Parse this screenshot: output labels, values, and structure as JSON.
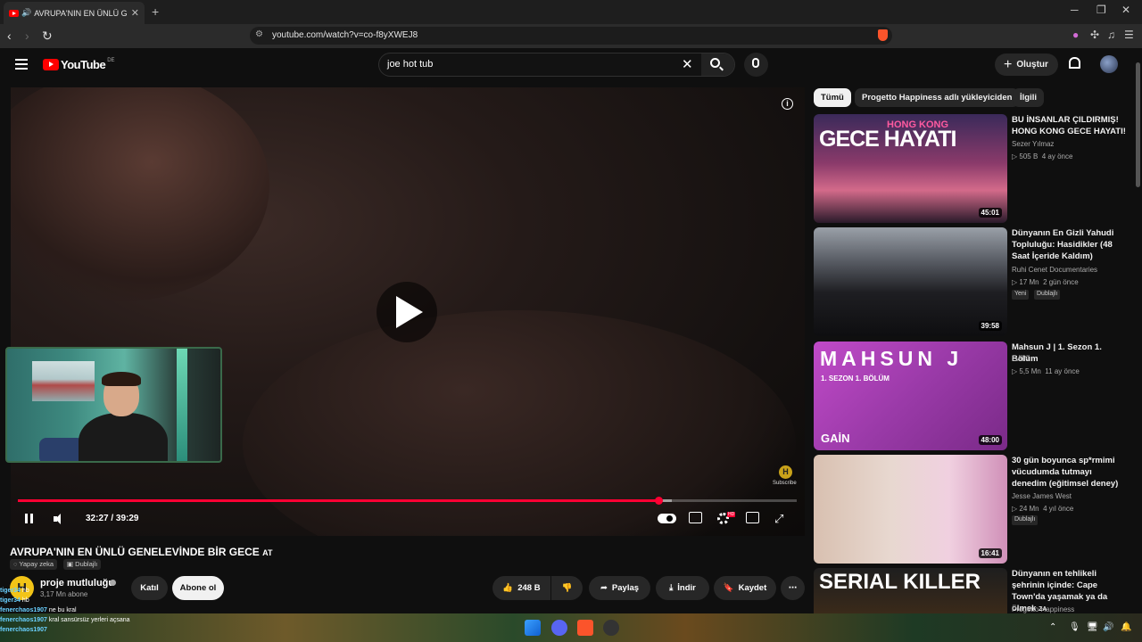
{
  "browser": {
    "tab_title": "AVRUPA'NIN EN ÜNLÜ GENELEVİNDE BİR GECE",
    "url": "youtube.com/watch?v=co-f8yXWEJ8"
  },
  "youtube": {
    "logo_text": "YouTube",
    "country": "DE",
    "search_value": "joe hot tub",
    "create_label": "Oluştur"
  },
  "player": {
    "time_current": "32:27",
    "time_total": "39:29",
    "time_display": "32:27 / 39:29",
    "progress_fraction": 0.822,
    "watermark_label": "Subscribe"
  },
  "video": {
    "title": "AVRUPA'NIN EN ÜNLÜ GENELEVİNDE BİR GECE",
    "title_suffix": "AT",
    "chips": [
      "Yapay zeka",
      "Dublajlı"
    ],
    "channel": {
      "avatar_letter": "H",
      "name": "proje mutluluğu",
      "subscribers": "3,17 Mn abone"
    },
    "join_label": "Katıl",
    "subscribe_label": "Abone ol",
    "like_count": "248 B",
    "share_label": "Paylaş",
    "download_label": "İndir",
    "save_label": "Kaydet"
  },
  "chat": [
    {
      "user": "tiger34",
      "msg": "hb"
    },
    {
      "user": "fenerchaos1907",
      "msg": "ne bu kral"
    },
    {
      "user": "fenerchaos1907",
      "msg": "kral sansürsüz yerleri açsana"
    },
    {
      "user": "fenerchaos1907",
      "msg": ""
    }
  ],
  "sidebar": {
    "filters": [
      "Tümü",
      "Progetto Happiness adlı yükleyiciden",
      "İlgili"
    ],
    "recommendations": [
      {
        "title": "BU İNSANLAR ÇILDIRMIŞ! HONG KONG GECE HAYATI!",
        "channel": "Sezer Yılmaz",
        "views": "505 B",
        "age": "4 ay önce",
        "duration": "45:01",
        "thumb_small": "HONG KONG",
        "thumb_big": "GECE HAYATI",
        "badges": []
      },
      {
        "title": "Dünyanın En Gizli Yahudi Topluluğu: Hasidikler (48 Saat İçeride Kaldım)",
        "channel": "Ruhi Cenet Documentaries",
        "views": "17 Mn",
        "age": "2 gün önce",
        "duration": "39:58",
        "badges": [
          "Yeni",
          "Dublajlı"
        ]
      },
      {
        "title": "Mahsun J | 1. Sezon 1. Bölüm",
        "channel": "GAİN",
        "views": "5,5 Mn",
        "age": "11 ay önce",
        "duration": "48:00",
        "thumb_big": "MAHSUN J",
        "thumb_small": "1. SEZON 1. BÖLÜM",
        "thumb_logo": "GAİN",
        "badges": []
      },
      {
        "title": "30 gün boyunca sp*rmimi vücudumda tutmayı denedim (eğitimsel deney)",
        "channel": "Jesse James West",
        "views": "24 Mn",
        "age": "4 yıl önce",
        "duration": "16:41",
        "badges": [
          "Dublajlı"
        ]
      },
      {
        "title": "Dünyanın en tehlikeli şehrinin içinde: Cape Town'da yaşamak ya da ölmek",
        "title_suffix": "ZA",
        "channel": "Progetto Happiness",
        "thumb_big": "SERIAL KILLER",
        "badges": []
      }
    ]
  },
  "colors": {
    "accent": "#ff0033",
    "background": "#0f0f0f",
    "chip": "#272727"
  }
}
